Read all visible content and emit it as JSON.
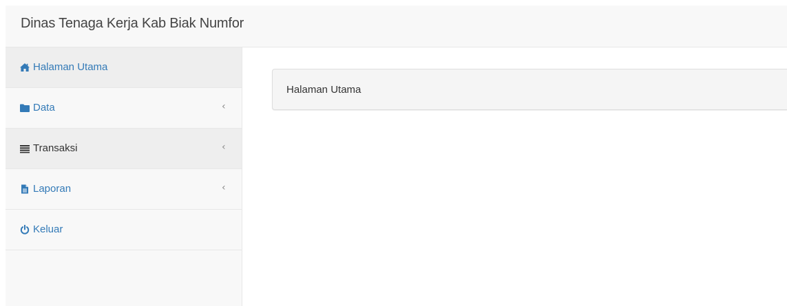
{
  "app": {
    "title": "Dinas Tenaga Kerja Kab Biak Numfor"
  },
  "sidebar": {
    "items": [
      {
        "label": "Halaman Utama",
        "icon": "home-icon",
        "has_submenu": false
      },
      {
        "label": "Data",
        "icon": "folder-icon",
        "has_submenu": true
      },
      {
        "label": "Transaksi",
        "icon": "list-icon",
        "has_submenu": true
      },
      {
        "label": "Laporan",
        "icon": "file-icon",
        "has_submenu": true
      },
      {
        "label": "Keluar",
        "icon": "power-icon",
        "has_submenu": false
      }
    ],
    "chevron": "‹"
  },
  "main": {
    "panel_title": "Halaman Utama"
  },
  "colors": {
    "link": "#337ab7",
    "navbar_bg": "#f8f8f8",
    "active_bg": "#eeeeee"
  }
}
